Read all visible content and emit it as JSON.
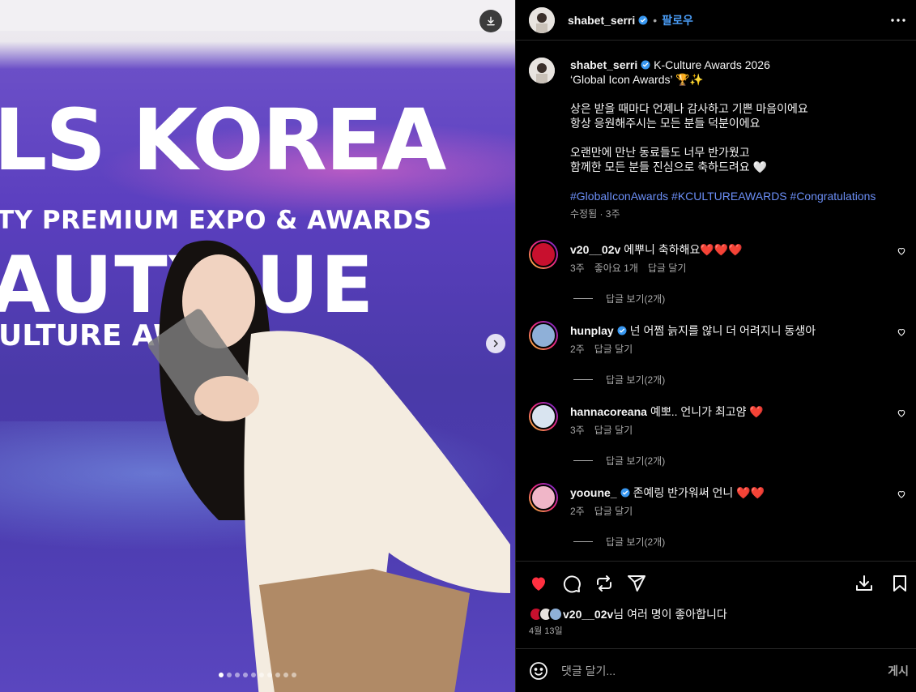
{
  "post": {
    "author": "shabet_serri",
    "follow_label": "팔로우",
    "dot": "•",
    "caption_lines": [
      "K-Culture Awards 2026",
      "‘Global Icon Awards’ 🏆✨",
      "",
      "상은 받을 때마다 언제나 감사하고 기쁜 마음이에요",
      "항상 응원해주시는 모든 분들 덕분이에요",
      "",
      "오랜만에 만난 동료들도 너무 반가웠고",
      "함께한 모든 분들 진심으로 축하드려요 🤍",
      ""
    ],
    "hashtags": "#GlobalIconAwards #KCULTUREAWARDS #Congratulations",
    "meta": "수정됨 · 3주"
  },
  "media": {
    "poster_title": "LS KOREA",
    "poster_sub": "TY PREMIUM EXPO & AWARDS",
    "poster_big": "AUTY UE",
    "poster_culture": "ULTURE AW",
    "slide_count": 10,
    "active_slide": 0
  },
  "comments": [
    {
      "user": "v20__02v",
      "verified": false,
      "text": "에뿌니 축하해요❤️❤️❤️",
      "time": "3주",
      "likes": "좋아요 1개",
      "reply": "답글 달기",
      "view_replies": "답글 보기(2개)",
      "avatar_color": "#c8102e"
    },
    {
      "user": "hunplay",
      "verified": true,
      "text": "넌 어쩜 늙지를 않니 더 어려지니 동생아",
      "time": "2주",
      "likes": "",
      "reply": "답글 달기",
      "view_replies": "답글 보기(2개)",
      "avatar_color": "#8fb0d8"
    },
    {
      "user": "hannacoreana",
      "verified": false,
      "text": "예뽀.. 언니가 최고얌 ❤️",
      "time": "3주",
      "likes": "",
      "reply": "답글 달기",
      "view_replies": "답글 보기(2개)",
      "avatar_color": "#d9e4f0"
    },
    {
      "user": "yooune_",
      "verified": true,
      "text": "존예링 반가워써 언니 ❤️❤️",
      "time": "2주",
      "likes": "",
      "reply": "답글 달기",
      "view_replies": "답글 보기(2개)",
      "avatar_color": "#f0b6c8"
    }
  ],
  "likes_summary": {
    "user": "v20__02v",
    "suffix": "님 여러 명이 좋아합니다"
  },
  "date": "4월 13일",
  "composer": {
    "placeholder": "댓글 달기...",
    "post_label": "게시"
  },
  "colors": {
    "accent": "#4a9cf5",
    "hashtag": "#6b8ef5",
    "like_red": "#ff3040",
    "muted": "#a8a8a8"
  },
  "icons": [
    "download-icon",
    "chevron-right-icon",
    "verified-badge-icon",
    "more-icon",
    "heart-icon",
    "comment-icon",
    "repost-icon",
    "share-icon",
    "save-post-icon",
    "bookmark-icon",
    "emoji-icon"
  ]
}
